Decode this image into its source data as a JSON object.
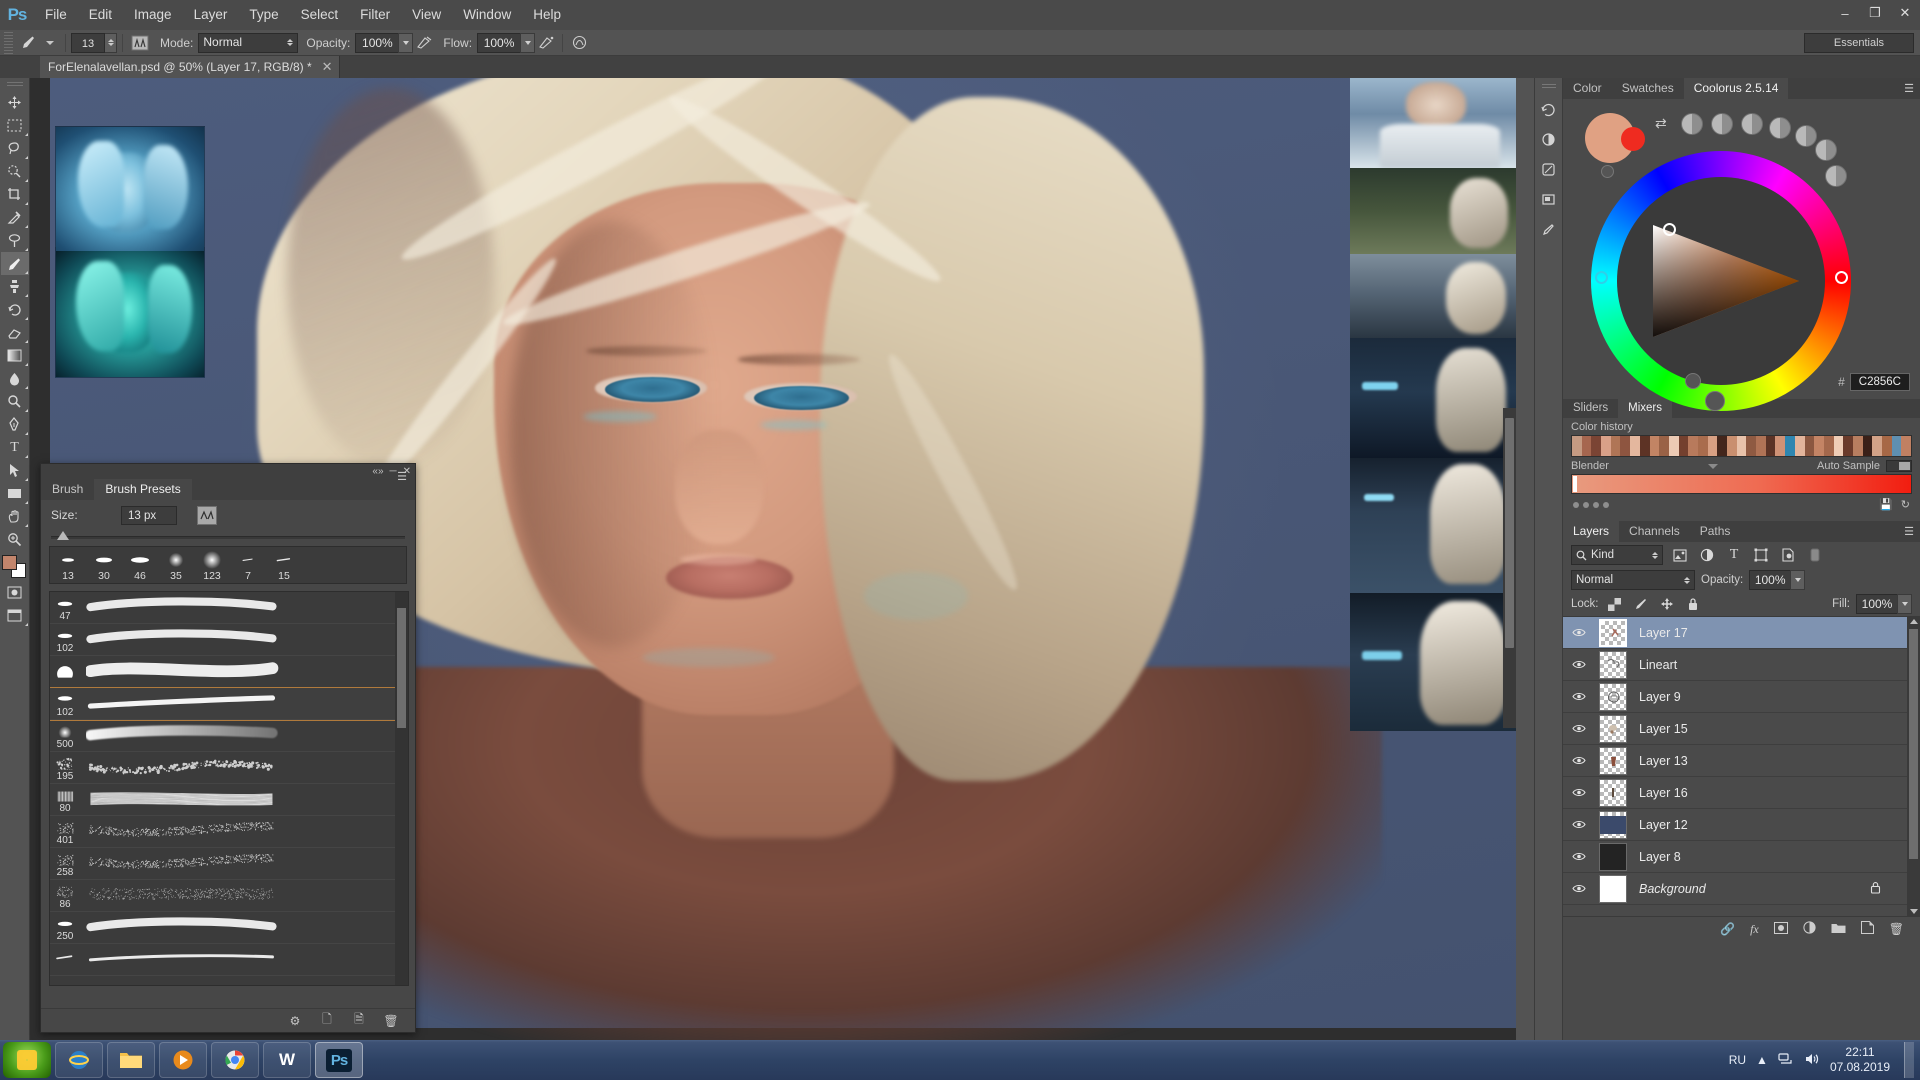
{
  "app": {
    "logo": "Ps",
    "menu": [
      "File",
      "Edit",
      "Image",
      "Layer",
      "Type",
      "Select",
      "Filter",
      "View",
      "Window",
      "Help"
    ],
    "window_buttons": {
      "minimize": "–",
      "restore": "❐",
      "close": "✕"
    },
    "workspace": "Essentials"
  },
  "options_bar": {
    "brush_size": "13",
    "mode_label": "Mode:",
    "mode_value": "Normal",
    "opacity_label": "Opacity:",
    "opacity_value": "100%",
    "flow_label": "Flow:",
    "flow_value": "100%"
  },
  "document": {
    "tab_title": "ForElenalavellan.psd @ 50% (Layer 17, RGB/8) *",
    "close_glyph": "✕",
    "zoom": "50%"
  },
  "toolbar": {
    "tools": [
      {
        "name": "move-tool",
        "glyph": "✥"
      },
      {
        "name": "rectangular-select-tool",
        "glyph": "⬚"
      },
      {
        "name": "lasso-tool",
        "glyph": "⌀"
      },
      {
        "name": "quick-select-tool",
        "glyph": "✿"
      },
      {
        "name": "crop-tool",
        "glyph": "⇱"
      },
      {
        "name": "eyedropper-tool",
        "glyph": "✒"
      },
      {
        "name": "spot-healing-tool",
        "glyph": "❁"
      },
      {
        "name": "brush-tool",
        "glyph": "╱"
      },
      {
        "name": "stamp-tool",
        "glyph": "⎙"
      },
      {
        "name": "history-brush-tool",
        "glyph": "↺"
      },
      {
        "name": "eraser-tool",
        "glyph": "◧"
      },
      {
        "name": "gradient-tool",
        "glyph": "▣"
      },
      {
        "name": "blur-tool",
        "glyph": "●"
      },
      {
        "name": "dodge-tool",
        "glyph": "◔"
      },
      {
        "name": "pen-tool",
        "glyph": "✒"
      },
      {
        "name": "type-tool",
        "glyph": "T"
      },
      {
        "name": "path-select-tool",
        "glyph": "➤"
      },
      {
        "name": "shape-tool",
        "glyph": "▭"
      },
      {
        "name": "hand-tool",
        "glyph": "✋"
      },
      {
        "name": "zoom-tool",
        "glyph": "⌕"
      }
    ],
    "foreground_color": "#C2856C",
    "background_color": "#FFFFFF"
  },
  "brush_panel": {
    "tabs": [
      {
        "label": "Brush",
        "active": false
      },
      {
        "label": "Brush Presets",
        "active": true
      }
    ],
    "size_label": "Size:",
    "size_value": "13 px",
    "quick_presets": [
      {
        "size": "13"
      },
      {
        "size": "30"
      },
      {
        "size": "46"
      },
      {
        "size": "35"
      },
      {
        "size": "123"
      },
      {
        "size": "7"
      },
      {
        "size": "15"
      }
    ],
    "presets": [
      {
        "size": "47",
        "selected": false,
        "tip": "round-soft"
      },
      {
        "size": "102",
        "selected": false,
        "tip": "round-soft"
      },
      {
        "size": "",
        "selected": false,
        "tip": "round-large"
      },
      {
        "size": "102",
        "selected": true,
        "tip": "flat-oval"
      },
      {
        "size": "500",
        "selected": false,
        "tip": "soft-glow"
      },
      {
        "size": "195",
        "selected": false,
        "tip": "texture-spatter"
      },
      {
        "size": "80",
        "selected": false,
        "tip": "bristle-flat"
      },
      {
        "size": "401",
        "selected": false,
        "tip": "chalk-grain"
      },
      {
        "size": "258",
        "selected": false,
        "tip": "chalk-grain"
      },
      {
        "size": "86",
        "selected": false,
        "tip": "noise-rough"
      },
      {
        "size": "250",
        "selected": false,
        "tip": "round-soft"
      },
      {
        "size": "",
        "selected": false,
        "tip": "flat-tapered"
      }
    ]
  },
  "color_panel": {
    "tabs": [
      {
        "label": "Color",
        "active": false
      },
      {
        "label": "Swatches",
        "active": false
      },
      {
        "label": "Coolorus 2.5.14",
        "active": true
      }
    ],
    "hash_symbol": "#",
    "hex_value": "C2856C",
    "current_color": "#E0A183",
    "secondary_color": "#EF2B20",
    "sub_tabs": [
      {
        "label": "Sliders",
        "active": false
      },
      {
        "label": "Mixers",
        "active": true
      }
    ],
    "color_history_label": "Color history",
    "blender_label": "Blender",
    "auto_sample_label": "Auto Sample",
    "color_history": [
      "#c59a82",
      "#a6664f",
      "#7b4434",
      "#d9a088",
      "#b07556",
      "#8e5540",
      "#e4b79e",
      "#5d3325",
      "#c28464",
      "#9a6246",
      "#eccab4",
      "#74402e",
      "#b87a5c",
      "#a96c4d",
      "#d8a083",
      "#43261c",
      "#c98f6f",
      "#e8c2aa",
      "#8f5a42",
      "#b07356",
      "#5b3326",
      "#cf9276",
      "#2f86b0",
      "#e2b49b",
      "#8b5740",
      "#c48465",
      "#a4684c",
      "#efcdb6",
      "#6b3b2b",
      "#b87e60",
      "#3a2018",
      "#d3a287",
      "#a76846",
      "#5f8fb0",
      "#c08062"
    ]
  },
  "layers_panel": {
    "tabs": [
      {
        "label": "Layers",
        "active": true
      },
      {
        "label": "Channels",
        "active": false
      },
      {
        "label": "Paths",
        "active": false
      }
    ],
    "filter_kind": "Kind",
    "blend_mode": "Normal",
    "opacity_label": "Opacity:",
    "opacity_value": "100%",
    "lock_label": "Lock:",
    "fill_label": "Fill:",
    "fill_value": "100%",
    "layers": [
      {
        "name": "Layer 17",
        "selected": true,
        "visible": true,
        "locked": false,
        "thumb": "transparent"
      },
      {
        "name": "Lineart",
        "selected": false,
        "visible": true,
        "locked": false,
        "thumb": "transparent"
      },
      {
        "name": "Layer 9",
        "selected": false,
        "visible": true,
        "locked": false,
        "thumb": "transparent"
      },
      {
        "name": "Layer 15",
        "selected": false,
        "visible": true,
        "locked": false,
        "thumb": "transparent"
      },
      {
        "name": "Layer 13",
        "selected": false,
        "visible": true,
        "locked": false,
        "thumb": "transparent"
      },
      {
        "name": "Layer 16",
        "selected": false,
        "visible": true,
        "locked": false,
        "thumb": "transparent"
      },
      {
        "name": "Layer 12",
        "selected": false,
        "visible": true,
        "locked": false,
        "thumb": "#3b4a6b"
      },
      {
        "name": "Layer 8",
        "selected": false,
        "visible": true,
        "locked": false,
        "thumb": "#232323"
      },
      {
        "name": "Background",
        "selected": false,
        "visible": true,
        "locked": true,
        "italic": true,
        "thumb": "#ffffff"
      }
    ],
    "footer_icons": [
      "link-icon",
      "fx-icon",
      "mask-icon",
      "adjustment-icon",
      "group-icon",
      "new-layer-icon",
      "delete-icon"
    ]
  },
  "taskbar": {
    "items": [
      "internet-explorer",
      "file-explorer",
      "media-player",
      "chrome",
      "wacom",
      "photoshop"
    ],
    "language": "RU",
    "time": "22:11",
    "date": "07.08.2019"
  }
}
